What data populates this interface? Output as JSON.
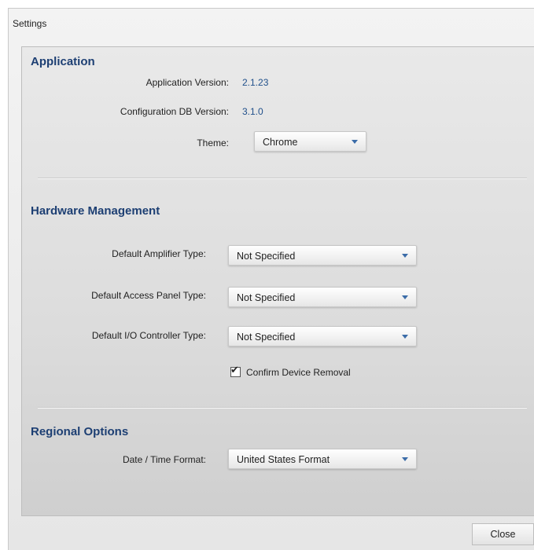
{
  "window": {
    "title": "Settings"
  },
  "application": {
    "section_title": "Application",
    "version_label": "Application Version:",
    "version_value": "2.1.23",
    "config_db_label": "Configuration DB Version:",
    "config_db_value": "3.1.0",
    "theme_label": "Theme:",
    "theme_value": "Chrome"
  },
  "hardware": {
    "section_title": "Hardware Management",
    "amplifier_label": "Default Amplifier Type:",
    "amplifier_value": "Not Specified",
    "access_panel_label": "Default Access Panel Type:",
    "access_panel_value": "Not Specified",
    "io_controller_label": "Default I/O Controller Type:",
    "io_controller_value": "Not Specified",
    "confirm_removal_label": "Confirm Device Removal",
    "confirm_removal_checked": true
  },
  "regional": {
    "section_title": "Regional Options",
    "datetime_label": "Date / Time Format:",
    "datetime_value": "United States Format"
  },
  "footer": {
    "close_label": "Close"
  },
  "colors": {
    "section_title": "#1d3f73",
    "value_text": "#1f4f8a",
    "dropdown_arrow": "#3b6ca8"
  },
  "icons": {
    "dropdown": "chevron-down-icon",
    "checkbox": "checkmark-icon"
  }
}
